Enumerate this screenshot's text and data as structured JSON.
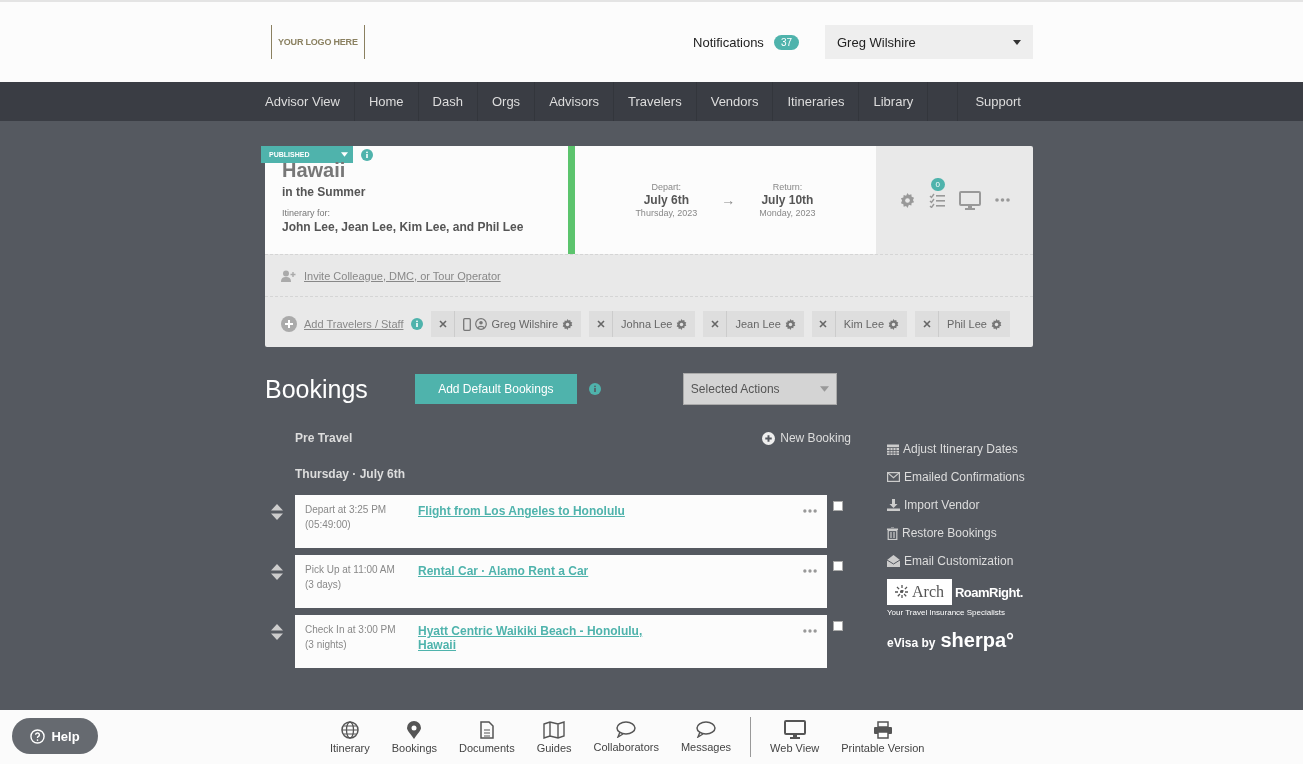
{
  "header": {
    "logo": "YOUR LOGO HERE",
    "notifications_label": "Notifications",
    "notifications_count": "37",
    "user": "Greg Wilshire"
  },
  "nav": {
    "items": [
      "Advisor View",
      "Home",
      "Dash",
      "Orgs",
      "Advisors",
      "Travelers",
      "Vendors",
      "Itineraries",
      "Library"
    ],
    "support": "Support"
  },
  "trip": {
    "status": "PUBLISHED",
    "title": "Hawaii",
    "subtitle": "in the Summer",
    "for_label": "Itinerary for:",
    "travelers_line": "John Lee, Jean Lee, Kim Lee, and Phil Lee",
    "depart_label": "Depart:",
    "depart_date": "July 6th",
    "depart_day": "Thursday, 2023",
    "arrow": "→",
    "return_label": "Return:",
    "return_date": "July 10th",
    "return_day": "Monday, 2023",
    "tasks_count": "0",
    "invite": "Invite Colleague, DMC, or Tour Operator",
    "add_travelers": "Add Travelers / Staff",
    "chips": [
      {
        "name": "Greg Wilshire",
        "kind": "device"
      },
      {
        "name": "Johna Lee",
        "kind": "person"
      },
      {
        "name": "Jean Lee",
        "kind": "person"
      },
      {
        "name": "Kim Lee",
        "kind": "person"
      },
      {
        "name": "Phil Lee",
        "kind": "person"
      }
    ]
  },
  "bookings": {
    "title": "Bookings",
    "add_default": "Add Default Bookings",
    "selected_actions": "Selected Actions",
    "section": "Pre Travel",
    "new_booking": "New Booking",
    "day": "Thursday · July 6th",
    "items": [
      {
        "time": "Depart at 3:25 PM",
        "detail": "(05:49:00)",
        "title": "Flight from Los Angeles to Honolulu",
        "checked": false
      },
      {
        "time": "Pick Up at 11:00 AM",
        "detail": "(3 days)",
        "title": "Rental Car · Alamo Rent a Car",
        "checked": false
      },
      {
        "time": "Check In at 3:00 PM",
        "detail": "(3 nights)",
        "title": "Hyatt Centric Waikiki Beach - Honolulu, Hawaii",
        "checked": false
      }
    ]
  },
  "side_actions": [
    {
      "label": "Adjust Itinerary Dates",
      "kind": "calendar"
    },
    {
      "label": "Emailed Confirmations",
      "kind": "envelope"
    },
    {
      "label": "Import Vendor",
      "kind": "download"
    },
    {
      "label": "Restore Bookings",
      "kind": "trash"
    },
    {
      "label": "Email Customization",
      "kind": "open-envelope"
    }
  ],
  "partners": {
    "arch": "Arch",
    "roamright": "RoamRight.",
    "tagline": "Your Travel Insurance Specialists",
    "evisa": "eVisa by",
    "sherpa": "sherpa°"
  },
  "help": "Help",
  "footer": {
    "main": [
      {
        "label": "Itinerary",
        "kind": "globe"
      },
      {
        "label": "Bookings",
        "kind": "pin"
      },
      {
        "label": "Documents",
        "kind": "document"
      },
      {
        "label": "Guides",
        "kind": "map"
      },
      {
        "label": "Collaborators",
        "kind": "bubble"
      },
      {
        "label": "Messages",
        "kind": "bubble"
      }
    ],
    "view": [
      {
        "label": "Web View",
        "kind": "monitor"
      },
      {
        "label": "Printable Version",
        "kind": "printer"
      }
    ]
  }
}
